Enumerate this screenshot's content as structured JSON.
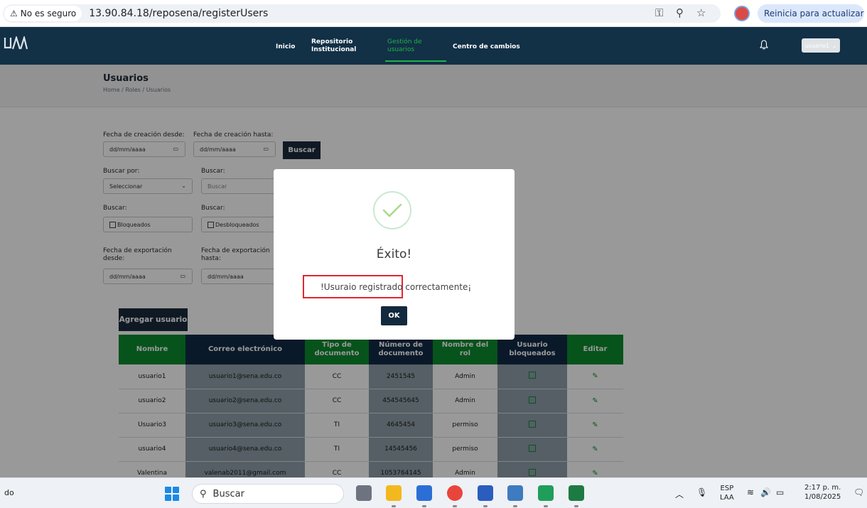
{
  "browser": {
    "not_secure_label": "No es seguro",
    "url": "13.90.84.18/reposena/registerUsers",
    "update_label": "Reinicia para actualizar"
  },
  "app_nav": {
    "logo_text": "UAA",
    "items": [
      {
        "label": "Inicio"
      },
      {
        "label_line1": "Repositorio",
        "label_line2": "Institucional"
      },
      {
        "label_line1": "Gestión de",
        "label_line2": "usuarios"
      },
      {
        "label": "Centro de cambios"
      }
    ],
    "user_label": "usuario1"
  },
  "page_header": {
    "title": "Usuarios",
    "breadcrumb": "Home / Roles / Usuarios"
  },
  "filters": {
    "created_from_label": "Fecha de creación desde:",
    "created_to_label": "Fecha de creación hasta:",
    "date_placeholder": "dd/mm/aaaa",
    "search_button": "Buscar",
    "search_by_label": "Buscar por:",
    "search_by_value": "Seleccionar",
    "search_label": "Buscar:",
    "search_placeholder": "Buscar",
    "blocked_label": "Buscar:",
    "blocked_option": "Bloqueados",
    "unblocked_label": "Buscar:",
    "unblocked_option": "Desbloqueados",
    "export_from_label_1": "Fecha de exportación",
    "export_from_label_2": "desde:",
    "export_to_label_1": "Fecha de exportación",
    "export_to_label_2": "hasta:"
  },
  "add_user_button": "Agregar usuario",
  "table": {
    "headers": [
      {
        "line1": "Nombre",
        "line2": ""
      },
      {
        "line1": "Correo electrónico",
        "line2": ""
      },
      {
        "line1": "Tipo de",
        "line2": "documento"
      },
      {
        "line1": "Número de",
        "line2": "documento"
      },
      {
        "line1": "Nombre del",
        "line2": "rol"
      },
      {
        "line1": "Usuario",
        "line2": "bloqueados"
      },
      {
        "line1": "Editar",
        "line2": ""
      }
    ],
    "rows": [
      {
        "name": "usuario1",
        "email": "usuario1@sena.edu.co",
        "doc_type": "CC",
        "doc_number": "2451545",
        "role": "Admin"
      },
      {
        "name": "usuario2",
        "email": "usuario2@sena.edu.co",
        "doc_type": "CC",
        "doc_number": "454545645",
        "role": "Admin"
      },
      {
        "name": "Usuario3",
        "email": "usuario3@sena.edu.co",
        "doc_type": "TI",
        "doc_number": "4645454",
        "role": "permiso"
      },
      {
        "name": "usuario4",
        "email": "usuario4@sena.edu.co",
        "doc_type": "TI",
        "doc_number": "14545456",
        "role": "permiso"
      },
      {
        "name": "Valentina",
        "email": "valenab2011@gmail.com",
        "doc_type": "CC",
        "doc_number": "1053764145",
        "role": "Admin"
      }
    ]
  },
  "modal": {
    "title": "Éxito!",
    "message": "!Usuraio registrado correctamente¡",
    "ok_button": "OK"
  },
  "taskbar": {
    "left_text": "do",
    "search_placeholder": "Buscar",
    "lang_line1": "ESP",
    "lang_line2": "LAA",
    "time": "2:17 p. m.",
    "date": "1/08/2025"
  },
  "colors": {
    "nav_bg": "#123046",
    "accent_green": "#1fb24a",
    "table_header_green": "#0b8a2e",
    "table_header_navy": "#112b45",
    "highlight_red": "#e3262e"
  }
}
